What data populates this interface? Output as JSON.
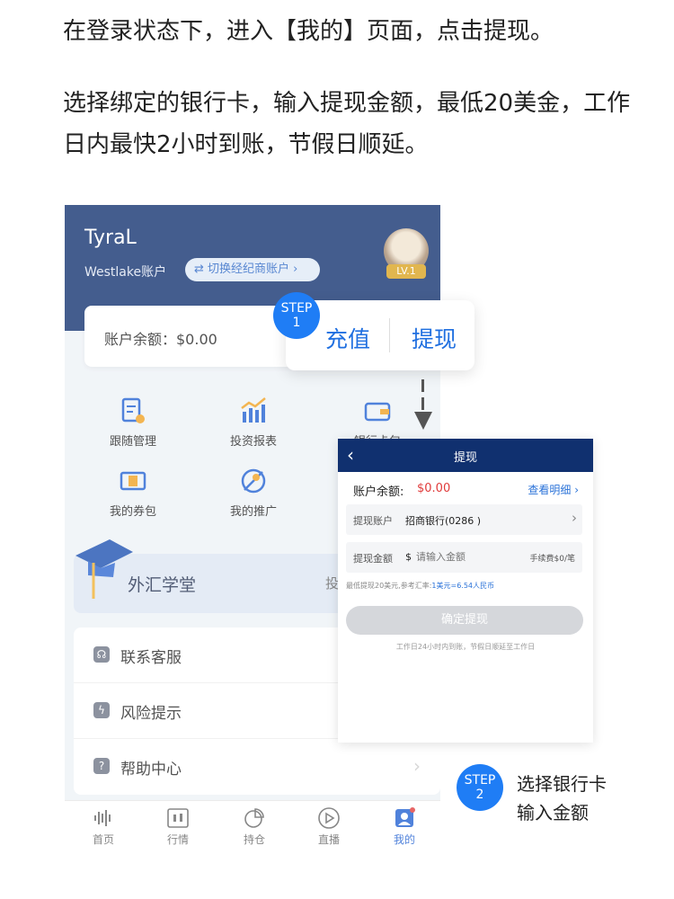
{
  "intro": {
    "line1": "在登录状态下，进入【我的】页面，点击提现。",
    "line2": "选择绑定的银行卡，输入提现金额，最低20美金，工作日内最快2小时到账，节假日顺延。"
  },
  "profile": {
    "username": "TyraL",
    "account_label": "Westlake账户",
    "switch_label": "⇄ 切换经纪商账户 ›",
    "level": "LV.1",
    "balance_text": "账户余额：$0.00"
  },
  "grid": [
    {
      "label": "跟随管理",
      "icon": "clipboard-gear-icon"
    },
    {
      "label": "投资报表",
      "icon": "bar-chart-icon"
    },
    {
      "label": "银行卡包",
      "icon": "wallet-icon"
    },
    {
      "label": "我的券包",
      "icon": "coupon-icon"
    },
    {
      "label": "我的推广",
      "icon": "promotion-icon"
    }
  ],
  "academy": {
    "title": "外汇学堂",
    "right_text": "投"
  },
  "menu": [
    {
      "label": "联系客服",
      "icon": "headset-icon"
    },
    {
      "label": "风险提示",
      "icon": "lightning-icon"
    },
    {
      "label": "帮助中心",
      "icon": "question-icon"
    }
  ],
  "tabs": [
    {
      "label": "首页",
      "icon": "home-wave-icon"
    },
    {
      "label": "行情",
      "icon": "candlestick-icon"
    },
    {
      "label": "持仓",
      "icon": "pie-icon"
    },
    {
      "label": "直播",
      "icon": "play-icon"
    },
    {
      "label": "我的",
      "icon": "user-icon"
    }
  ],
  "step1": {
    "step_word": "STEP",
    "step_num": "1",
    "recharge": "充值",
    "withdraw": "提现"
  },
  "withdraw_screen": {
    "title": "提现",
    "balance_label": "账户余额:",
    "balance_value": "$0.00",
    "detail_link": "查看明细 ›",
    "account_label": "提现账户",
    "account_value": "招商银行(0286 )",
    "amount_label": "提现金额",
    "currency": "$",
    "amount_placeholder": "请输入金额",
    "fee": "手续费$0/笔",
    "note": "最低提现20美元,参考汇率:",
    "note_rate": "1美元=6.54人民币",
    "confirm": "确定提现",
    "footnote": "工作日24小时内到账，节假日顺延至工作日"
  },
  "step2": {
    "step_word": "STEP",
    "step_num": "2",
    "line1": "选择银行卡",
    "line2": "输入金额"
  },
  "colors": {
    "navy": "#10306f",
    "accent": "#1f7df5",
    "red": "#e03a3a"
  }
}
